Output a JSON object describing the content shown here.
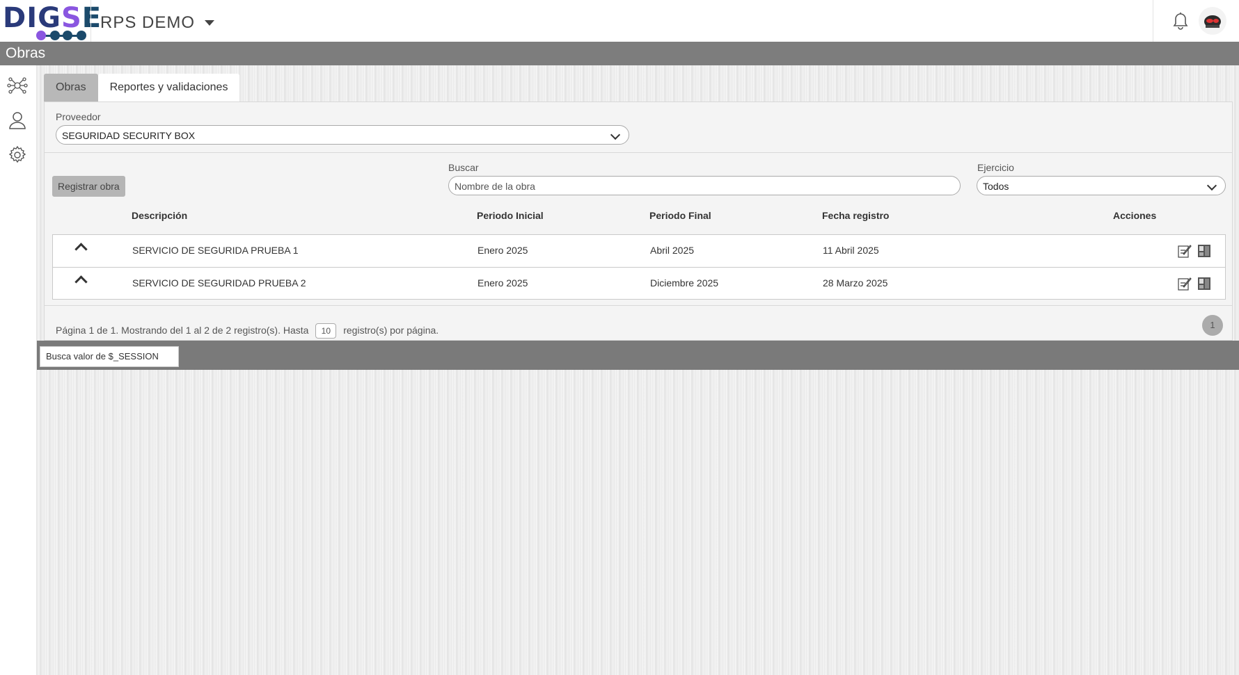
{
  "header": {
    "logo_text": "DIGSE",
    "project_title": "RPS DEMO",
    "colors": {
      "logo_primary": "#2a3a7a",
      "logo_accent": "#8a56e0",
      "logo_dark": "#1b4a6b"
    }
  },
  "page": {
    "title": "Obras"
  },
  "sidebar": {
    "items": [
      {
        "icon": "network-icon"
      },
      {
        "icon": "user-icon"
      },
      {
        "icon": "gear-icon"
      }
    ]
  },
  "tabs": [
    {
      "label": "Obras",
      "active": true
    },
    {
      "label": "Reportes y validaciones",
      "active": false
    }
  ],
  "filters": {
    "proveedor_label": "Proveedor",
    "proveedor_value": "SEGURIDAD SECURITY BOX",
    "buscar_label": "Buscar",
    "buscar_placeholder": "Nombre de la obra",
    "ejercicio_label": "Ejercicio",
    "ejercicio_value": "Todos"
  },
  "actions": {
    "register_label": "Registrar obra"
  },
  "table": {
    "columns": [
      "Descripción",
      "Periodo Inicial",
      "Periodo Final",
      "Fecha registro",
      "Acciones"
    ],
    "rows": [
      {
        "descripcion": "SERVICIO DE SEGURIDA PRUEBA 1",
        "periodo_inicial": "Enero 2025",
        "periodo_final": "Abril 2025",
        "fecha_registro": "11 Abril 2025"
      },
      {
        "descripcion": "SERVICIO DE SEGURIDAD PRUEBA 2",
        "periodo_inicial": "Enero 2025",
        "periodo_final": "Diciembre 2025",
        "fecha_registro": "28 Marzo 2025"
      }
    ]
  },
  "pagination": {
    "summary": "Página 1 de 1. Mostrando del 1 al 2 de 2 registro(s). Hasta",
    "per_page": "10",
    "suffix": "registro(s) por página.",
    "current_page": "1"
  },
  "session": {
    "input_value": "Busca valor de $_SESSION"
  }
}
